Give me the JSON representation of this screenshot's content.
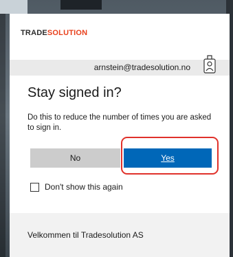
{
  "logo": {
    "part1": "TRADE",
    "part2": "SOLUTION"
  },
  "account": {
    "email": "arnstein@tradesolution.no",
    "icon": "badge-icon"
  },
  "dialog": {
    "title": "Stay signed in?",
    "description": "Do this to reduce the number of times you are asked to sign in.",
    "no_label": "No",
    "yes_label": "Yes",
    "checkbox_label": "Don't show this again",
    "checkbox_checked": false
  },
  "footer": {
    "text": "Velkommen til Tradesolution AS"
  },
  "colors": {
    "primary": "#0067b8",
    "secondary_button": "#cccccc",
    "highlight": "#e0312a",
    "logo_accent": "#e8401c"
  }
}
